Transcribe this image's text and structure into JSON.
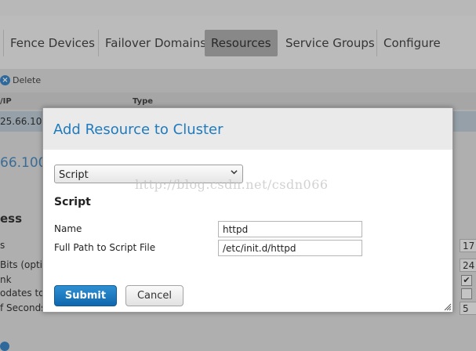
{
  "nav": {
    "tabs": [
      {
        "label": "Fence Devices"
      },
      {
        "label": "Failover Domains"
      },
      {
        "label": "Resources",
        "active": true
      },
      {
        "label": "Service Groups"
      },
      {
        "label": "Configure"
      }
    ]
  },
  "toolbar": {
    "delete_label": "Delete"
  },
  "table": {
    "headers": [
      "/IP",
      "Type"
    ],
    "selected_row": [
      "25.66.10"
    ]
  },
  "detail": {
    "address": "66.100",
    "section_title": "ess",
    "field_labels": [
      "s",
      "Bits (opti",
      "nk",
      "odates to",
      "f Seconds"
    ],
    "field_values": [
      "17",
      "24",
      "",
      "",
      "5"
    ],
    "checks": [
      true,
      false
    ]
  },
  "modal": {
    "title": "Add Resource to Cluster",
    "resource_type": "Script",
    "subheading": "Script",
    "fields": [
      {
        "label": "Name",
        "value": "httpd"
      },
      {
        "label": "Full Path to Script File",
        "value": "/etc/init.d/httpd"
      }
    ],
    "submit_label": "Submit",
    "cancel_label": "Cancel"
  },
  "watermark": "http://blog.csdn.net/csdn066",
  "colors": {
    "accent": "#1f7bbd",
    "submit": "#1a74b8"
  }
}
